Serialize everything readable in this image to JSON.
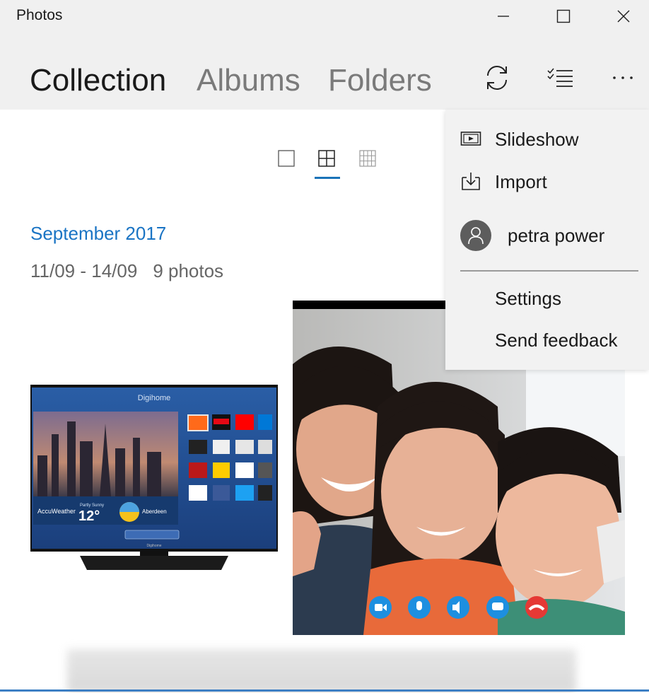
{
  "window": {
    "title": "Photos",
    "controls": [
      "minimize-icon",
      "maximize-icon",
      "close-icon"
    ]
  },
  "header": {
    "tabs": [
      {
        "label": "Collection",
        "active": true
      },
      {
        "label": "Albums",
        "active": false
      },
      {
        "label": "Folders",
        "active": false
      }
    ],
    "actions": [
      "refresh-icon",
      "select-icon",
      "more-icon"
    ]
  },
  "view_sizes": {
    "options": [
      "large-tiles-icon",
      "medium-tiles-icon",
      "small-tiles-icon"
    ],
    "selected": "medium-tiles-icon"
  },
  "group": {
    "month": "September 2017",
    "range": "11/09 - 14/09",
    "count": "9 photos"
  },
  "tv_photo": {
    "brand": "Digihome",
    "weather_provider": "AccuWeather",
    "condition": "Partly Sunny",
    "temperature": "12°",
    "city": "Aberdeen",
    "footer_brand": "Digihome",
    "apps": [
      "Freeview Play",
      "NETFLIX",
      "YouTube",
      "BBC iPlayer",
      "ITV Hub",
      "BBC NEWS",
      "BBC SPORT",
      "flickr",
      "Facebook",
      "Twitter"
    ]
  },
  "menu": {
    "items": [
      {
        "label": "Slideshow",
        "icon": "slideshow-icon"
      },
      {
        "label": "Import",
        "icon": "import-icon"
      }
    ],
    "account": {
      "name": "petra power",
      "icon": "person-icon"
    },
    "secondary": [
      {
        "label": "Settings"
      },
      {
        "label": "Send feedback"
      }
    ]
  },
  "colors": {
    "accent": "#1a74c4",
    "chrome": "#f0f0f0",
    "menu": "#f2f2f2"
  }
}
